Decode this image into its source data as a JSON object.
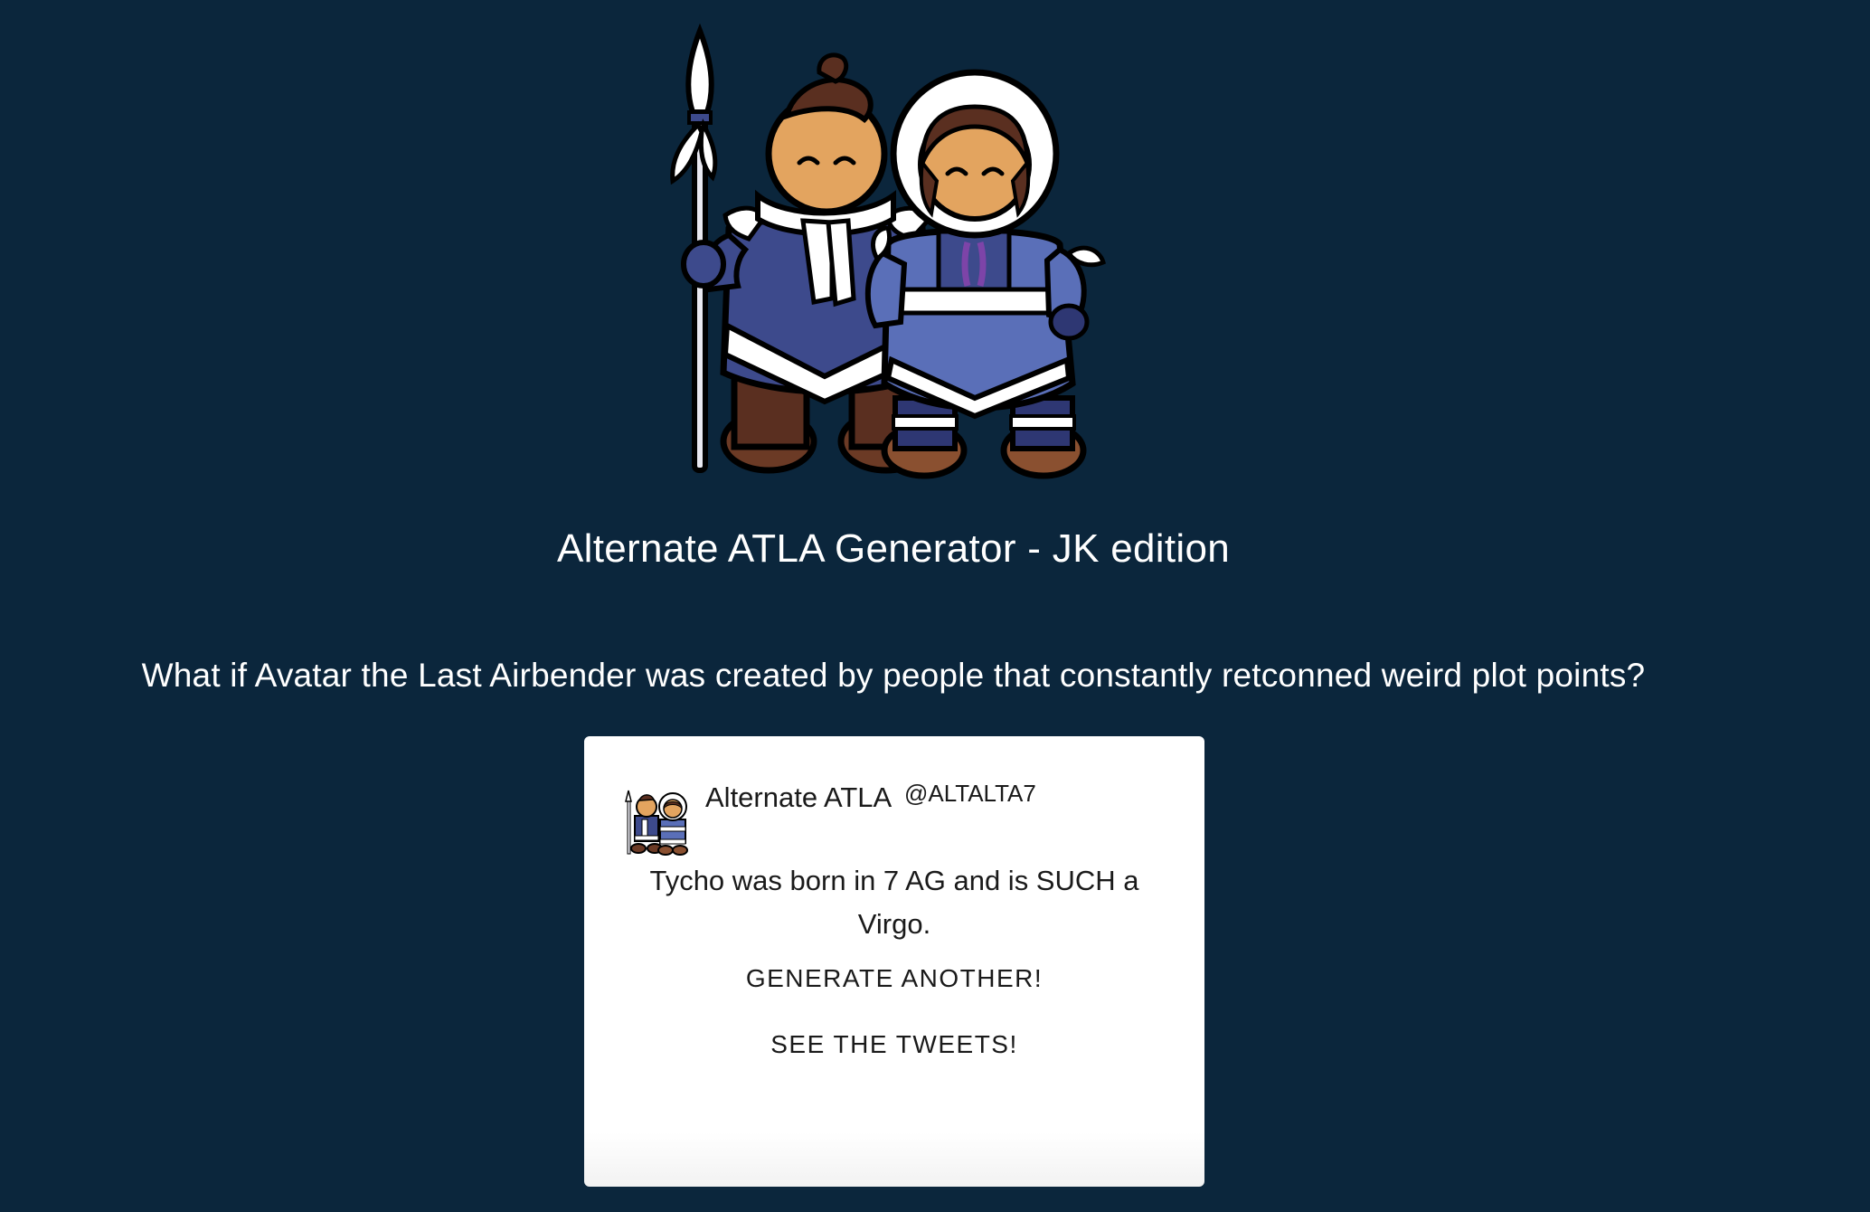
{
  "header": {
    "title": "Alternate ATLA Generator - JK edition",
    "question": "What if Avatar the Last Airbender was created by people that constantly retconned weird plot points?"
  },
  "tweet": {
    "display_name": "Alternate ATLA",
    "handle": "@ALTALTA7",
    "text": "Tycho was born in 7 AG and is SUCH a Virgo."
  },
  "buttons": {
    "generate_label": "GENERATE ANOTHER!",
    "tweets_label": "SEE THE TWEETS!"
  },
  "colors": {
    "background": "#0b263c",
    "card": "#ffffff",
    "parka_blue": "#3d4a8c",
    "parka_light": "#5a6fb8",
    "skin": "#e3a45f",
    "boots": "#6b3a25"
  },
  "icons": {
    "hero": "sokka-katara-illustration",
    "avatar": "sokka-katara-avatar-icon"
  }
}
